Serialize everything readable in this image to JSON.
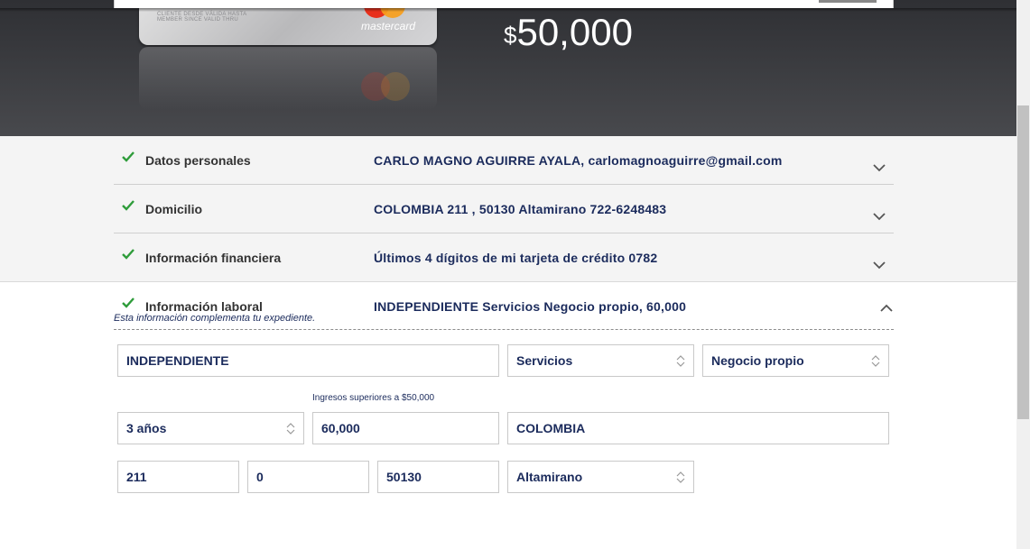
{
  "hero": {
    "card_text_line1": "CLIENTE DESDE  VÁLIDA HASTA",
    "card_text_line2": "MEMBER SINCE   VALID THRU",
    "card_brand": "mastercard",
    "currency_symbol": "$",
    "amount": "50,000"
  },
  "sections": [
    {
      "label": "Datos personales",
      "value": "CARLO MAGNO AGUIRRE AYALA, carlomagnoaguirre@gmail.com",
      "completed": true,
      "expanded": false
    },
    {
      "label": "Domicilio",
      "value": "COLOMBIA 211 , 50130 Altamirano 722-6248483",
      "completed": true,
      "expanded": false
    },
    {
      "label": "Información financiera",
      "value": "Últimos 4 dígitos de mi tarjeta de crédito 0782",
      "completed": true,
      "expanded": false
    },
    {
      "label": "Información laboral",
      "value": "INDEPENDIENTE Servicios Negocio propio, 60,000",
      "completed": true,
      "expanded": true
    }
  ],
  "laboral": {
    "note": "Esta información complementa tu expediente.",
    "income_hint": "Ingresos superiores a $50,000",
    "employment_type": "INDEPENDIENTE",
    "sector": "Servicios",
    "business": "Negocio propio",
    "seniority": "3 años",
    "income": "60,000",
    "street": "COLOMBIA",
    "ext_number": "211",
    "int_number": "0",
    "postal_code": "50130",
    "city": "Altamirano"
  },
  "colors": {
    "accent_text": "#1b2b5c",
    "check_green": "#2e9c3a",
    "hero_bg": "#3e3f43"
  }
}
